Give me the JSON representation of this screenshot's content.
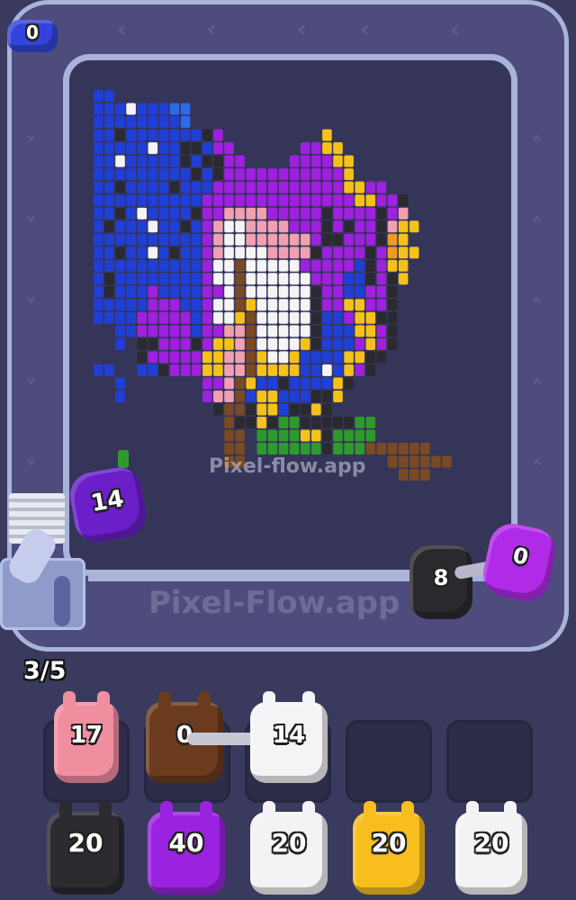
{
  "app": {
    "watermark_board": "Pixel-flow.app",
    "watermark_track": "Pixel-Flow.app"
  },
  "hud": {
    "capacity_label": "3/5"
  },
  "track": {
    "feeder_creature": {
      "color": "#3344dd",
      "count": "0"
    },
    "shooters": [
      {
        "name": "purple-shooter",
        "color": "#6a1fc8",
        "count": "14"
      },
      {
        "name": "black-shooter",
        "color": "#2a2a2e",
        "count": "8"
      },
      {
        "name": "magenta-shooter",
        "color": "#b02be8",
        "count": "0"
      }
    ]
  },
  "slots": {
    "row1": [
      {
        "color": "#f08ea0",
        "count": "17",
        "empty": false
      },
      {
        "color": "#6b3b1e",
        "count": "0",
        "empty": false
      },
      {
        "color": "#f4f4f6",
        "count": "14",
        "empty": false
      },
      {
        "color": "",
        "count": "",
        "empty": true
      },
      {
        "color": "",
        "count": "",
        "empty": true
      }
    ],
    "row2": [
      {
        "color": "#2b2b30",
        "count": "20"
      },
      {
        "color": "#9a22e0",
        "count": "40"
      },
      {
        "color": "#f3f3f5",
        "count": "20"
      },
      {
        "color": "#f7be1e",
        "count": "20"
      },
      {
        "color": "#f3f3f5",
        "count": "20"
      }
    ]
  },
  "palette": {
    "B": "#1f3fd6",
    "L": "#2a6be8",
    "W": "#f4f4f4",
    "K": "#2a2a30",
    "P": "#a020e0",
    "V": "#6a1fc0",
    "Y": "#f5c21a",
    "G": "#2e9a2e",
    "N": "#7a4a24",
    "R": "#f0a0b0",
    "S": "#e8d0a0",
    "O": "#f09a20"
  },
  "pixel_art": [
    "BB.........................................",
    "BBBWBBBLL......................................",
    "BBBBBBBBL..........................",
    "BBKBBBBBBBKP.........Y...........",
    "BBBBBWBBKKBPP......PPYY.........",
    "BBWBBBBBKBKKPP....PPPPYY.........",
    "BBBBBBBBBKBKPPPPPPPPPPPY.........",
    "BBKBBBBKBBBPPPPPPPPPPPPYYPP.......",
    "BBBBBBBBBBPPPPPPPPPPPPPPYYPPK.....",
    "BBKBWBBBBKPPRRRRPPPPPKPPPPKPR....",
    "BKBBBWBBKBPRWWRRRRPPPKPKPPKRYY...",
    "BBBBBBBBBBPRWWRRRRRRPKKPPPKOY....",
    "BBKBBWBKBBPRWWWWRRRRKPPPPKPOYY...",
    "BBBBBBBBBBPWWNWWWWWPPPPPBKPYY....",
    "BKBBBBBBBBPWWNWWWWWWPPPBBKPKY....",
    "BKBBBPBBBBPPWNWWWWWWKPPBBPPK.....",
    "BBBBBPPPBBPWWNYWWWWWKPPYYPPK.....",
    "BBBBPPPPPBPWWYNWWWWWKBBPYYKK.....",
    "..BBPPPPPBPPRRNWWWWWKBBBYYPK.....",
    "..B.KKPPPKPYYRNWWWWYKBBBPYPK.....",
    "....KPPPPPYYRRNYWWYBBBBYYKK......",
    "BB..BBKPPPYYRRNYYYYBBWBYPK.......",
    "..B.......PPRNYBBKBBBBYK.........",
    "..B.......PRRNBYYBBBKKY..........",
    "...........KNNKYYBKKYK...........",
    "............NKKYKGGKKKKKGG.......",
    "............NN.GGGGYYKGGGG.......",
    "............NN.GGGGGGKGGGNNNNNN..",
    "............NN.............NNNNNN",
    "............................NNN.."
  ]
}
